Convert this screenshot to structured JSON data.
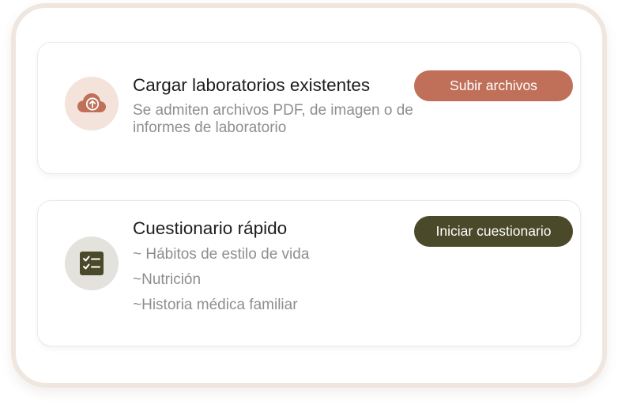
{
  "colors": {
    "upload_accent": "#c07059",
    "upload_icon_bg": "#f3e3da",
    "quiz_accent": "#4a4a2a",
    "quiz_icon_bg": "#e3e2dc",
    "title_text": "#1d1d1d",
    "secondary_text": "#8e8e8e"
  },
  "upload_card": {
    "icon": "cloud-upload-icon",
    "title": "Cargar laboratorios existentes",
    "description": "Se admiten archivos PDF, de imagen o de informes de laboratorio",
    "button_label": "Subir archivos"
  },
  "quiz_card": {
    "icon": "checklist-icon",
    "title": "Cuestionario rápido",
    "items": [
      "~ Hábitos de estilo de vida",
      "~Nutrición",
      "~Historia médica familiar"
    ],
    "button_label": "Iniciar cuestionario"
  }
}
